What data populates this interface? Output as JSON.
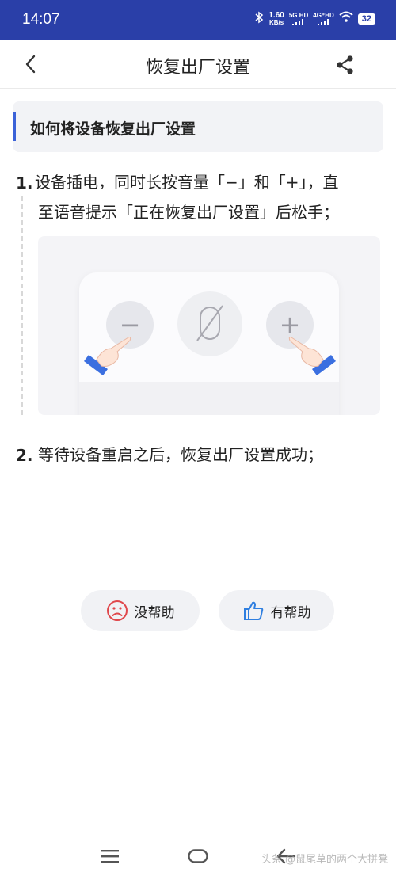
{
  "status_bar": {
    "time": "14:07",
    "net_speed_value": "1.60",
    "net_speed_unit": "KB/s",
    "sim1_label": "5G HD",
    "sim2_label": "4G⁺HD",
    "battery": "32"
  },
  "header": {
    "title": "恢复出厂设置"
  },
  "section": {
    "title": "如何将设备恢复出厂设置"
  },
  "steps": [
    {
      "number": "1.",
      "line1": "设备插电，同时长按音量「−」和「+」，直",
      "line2": "至语音提示「正在恢复出厂设置」后松手；"
    },
    {
      "number": "2.",
      "line1": "等待设备重启之后，恢复出厂设置成功；"
    }
  ],
  "illustration": {
    "minus_symbol": "−",
    "plus_symbol": "+"
  },
  "feedback": {
    "not_helpful_label": "没帮助",
    "helpful_label": "有帮助"
  },
  "watermark": "头条 @鼠尾草的两个大拼凳",
  "colors": {
    "status_bar_bg": "#2a3fa8",
    "accent": "#3b62d8",
    "not_helpful_icon": "#e0484c",
    "helpful_icon": "#2f7fe0"
  },
  "icons": {
    "back": "chevron-left-icon",
    "share": "share-icon",
    "sad_face": "sad-face-icon",
    "thumbs_up": "thumbs-up-icon",
    "nav_menu": "menu-icon",
    "nav_home": "home-icon",
    "nav_back": "back-arrow-icon"
  }
}
